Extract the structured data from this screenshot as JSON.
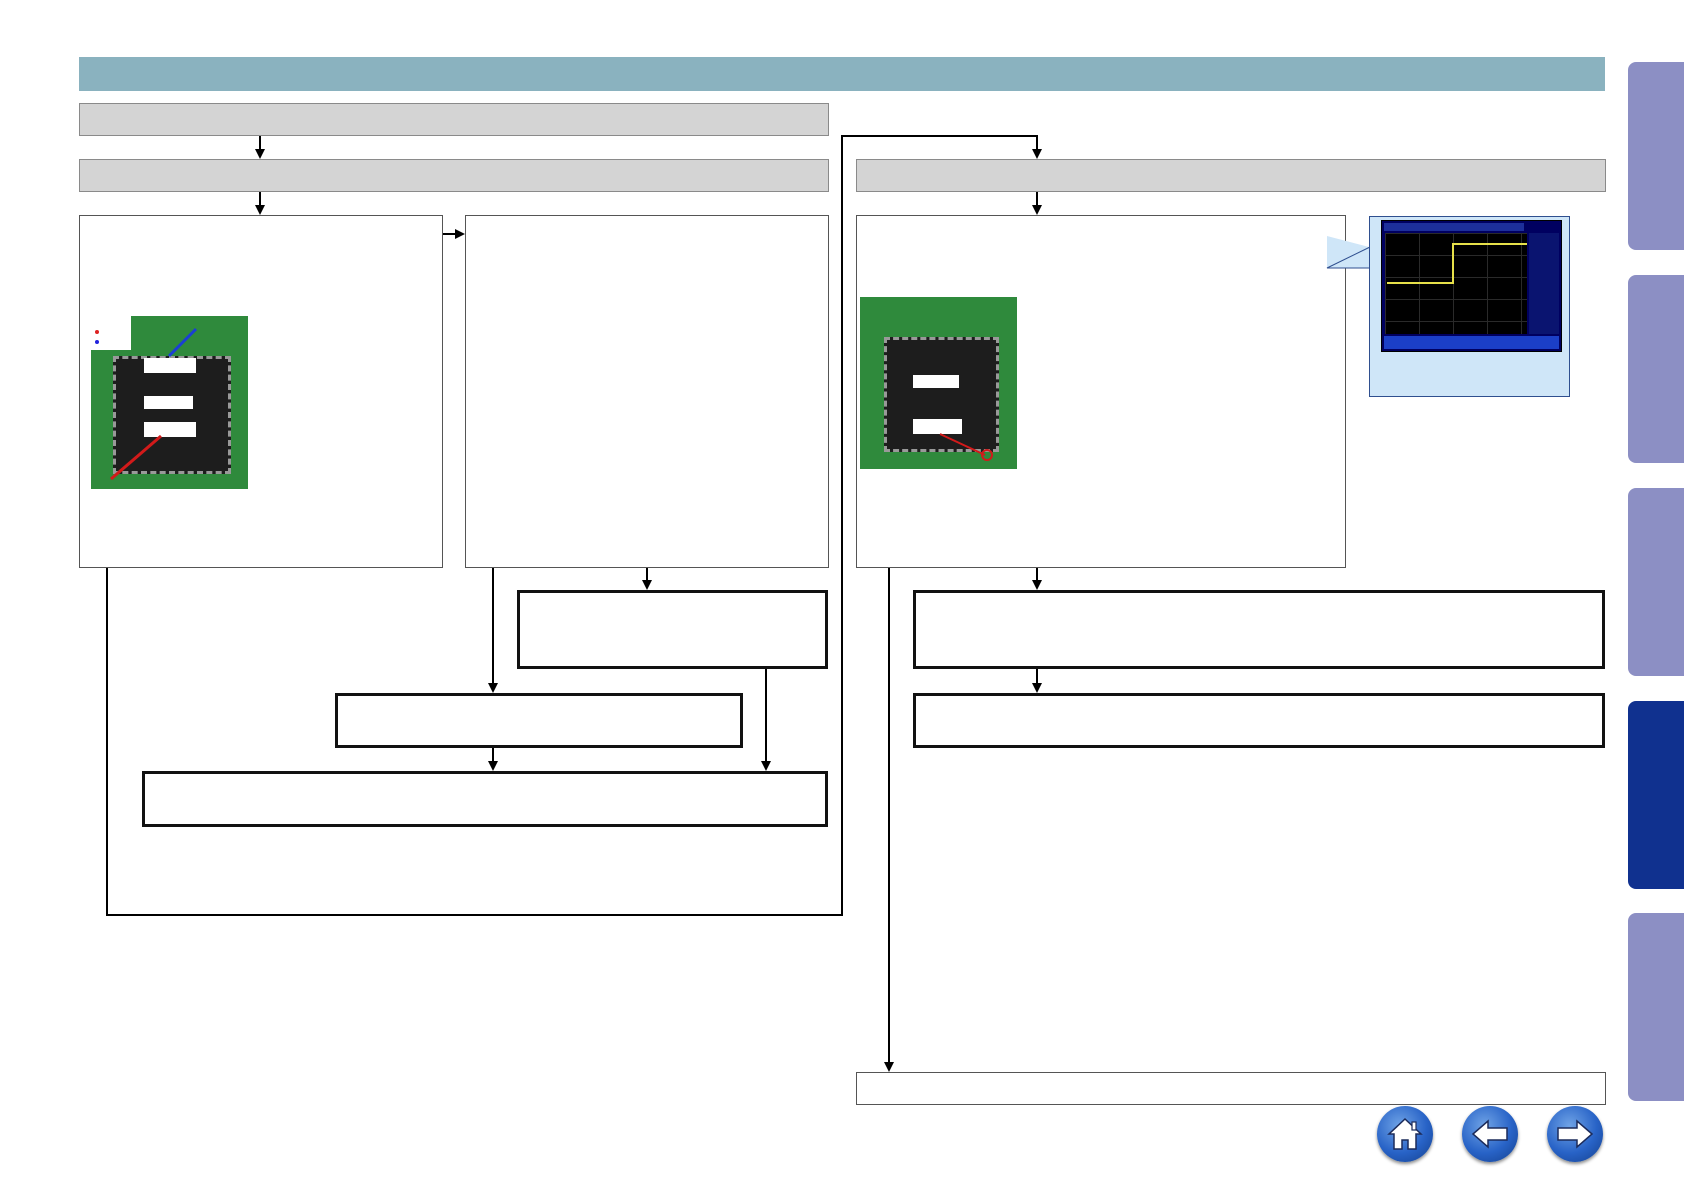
{
  "page": {
    "title": "",
    "colors": {
      "header_bar": "#8ab2bf",
      "side_tab": "#8c8fc4",
      "side_tab_active": "#10318f",
      "nav_button": "#2863c7",
      "scope_trace": "#e6e04a"
    }
  },
  "side_tabs": [
    {
      "label": "",
      "active": false
    },
    {
      "label": "",
      "active": false
    },
    {
      "label": "",
      "active": false
    },
    {
      "label": "",
      "active": true
    },
    {
      "label": "",
      "active": false
    }
  ],
  "nav": {
    "home_icon": "home-icon",
    "back_icon": "arrow-left-icon",
    "forward_icon": "arrow-right-icon"
  },
  "boxes": {
    "top_left_title": "",
    "left_title": "",
    "right_title": "",
    "left_panel_text": "",
    "middle_panel_text": "",
    "right_panel_text": "",
    "middle_result_box": "",
    "left_mid_box": "",
    "left_bottom_box": "",
    "right_result_box_1": "",
    "right_result_box_2": "",
    "right_final_box": ""
  }
}
